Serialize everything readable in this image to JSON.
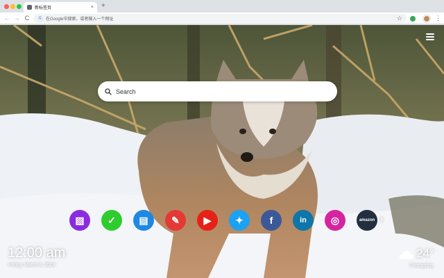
{
  "browser": {
    "tab_title": "新标签页",
    "tab_close": "×",
    "new_tab": "+",
    "back": "←",
    "forward": "→",
    "reload": "C",
    "omnibox_text": "在Google中搜索，或者输入一个网址",
    "google_letter": "G",
    "bookmark_star": "☆",
    "menu": "⋮"
  },
  "search": {
    "placeholder": "Search"
  },
  "shortcuts": [
    {
      "name": "photo-editor",
      "glyph": "▨",
      "color": "#8a2be2"
    },
    {
      "name": "tasks",
      "glyph": "✓",
      "color": "#2ecc2e"
    },
    {
      "name": "notes",
      "glyph": "▤",
      "color": "#1e88e5"
    },
    {
      "name": "paint",
      "glyph": "✎",
      "color": "#e53935"
    },
    {
      "name": "youtube",
      "glyph": "▶",
      "color": "#e62117"
    },
    {
      "name": "twitter",
      "glyph": "✦",
      "color": "#1da1f2"
    },
    {
      "name": "facebook",
      "glyph": "f",
      "color": "#3b5998"
    },
    {
      "name": "linkedin",
      "glyph": "in",
      "color": "#0e76a8"
    },
    {
      "name": "instagram",
      "glyph": "◎",
      "color": "#d6249f"
    },
    {
      "name": "amazon",
      "glyph": "amazon",
      "color": "#232f3e"
    }
  ],
  "shortcuts_next": "›",
  "clock": {
    "time": "12:00 am",
    "date": "Friday, March 8, 2019"
  },
  "weather": {
    "temperature": "24°",
    "city": "Chongqing"
  },
  "colors": {
    "accent": "#ffffff",
    "sky": "#dee1e6"
  }
}
